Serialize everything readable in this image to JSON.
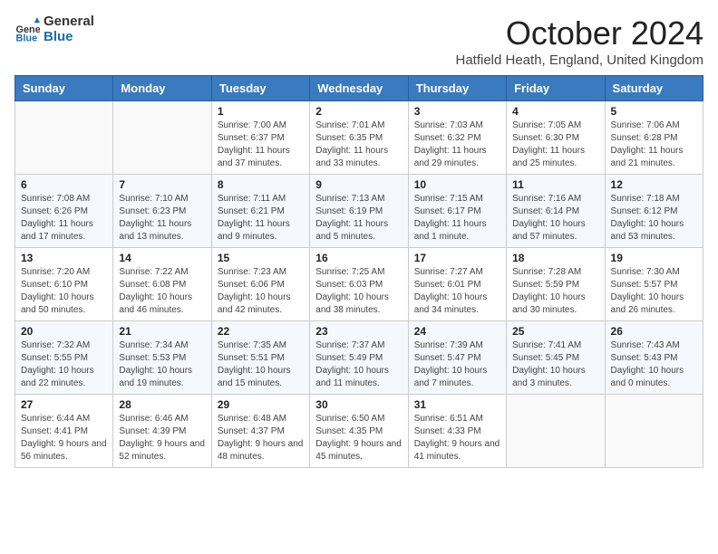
{
  "header": {
    "logo": {
      "general": "General",
      "blue": "Blue"
    },
    "month": "October 2024",
    "location": "Hatfield Heath, England, United Kingdom"
  },
  "days_of_week": [
    "Sunday",
    "Monday",
    "Tuesday",
    "Wednesday",
    "Thursday",
    "Friday",
    "Saturday"
  ],
  "weeks": [
    [
      {
        "day": "",
        "sunrise": "",
        "sunset": "",
        "daylight": ""
      },
      {
        "day": "",
        "sunrise": "",
        "sunset": "",
        "daylight": ""
      },
      {
        "day": "1",
        "sunrise": "Sunrise: 7:00 AM",
        "sunset": "Sunset: 6:37 PM",
        "daylight": "Daylight: 11 hours and 37 minutes."
      },
      {
        "day": "2",
        "sunrise": "Sunrise: 7:01 AM",
        "sunset": "Sunset: 6:35 PM",
        "daylight": "Daylight: 11 hours and 33 minutes."
      },
      {
        "day": "3",
        "sunrise": "Sunrise: 7:03 AM",
        "sunset": "Sunset: 6:32 PM",
        "daylight": "Daylight: 11 hours and 29 minutes."
      },
      {
        "day": "4",
        "sunrise": "Sunrise: 7:05 AM",
        "sunset": "Sunset: 6:30 PM",
        "daylight": "Daylight: 11 hours and 25 minutes."
      },
      {
        "day": "5",
        "sunrise": "Sunrise: 7:06 AM",
        "sunset": "Sunset: 6:28 PM",
        "daylight": "Daylight: 11 hours and 21 minutes."
      }
    ],
    [
      {
        "day": "6",
        "sunrise": "Sunrise: 7:08 AM",
        "sunset": "Sunset: 6:26 PM",
        "daylight": "Daylight: 11 hours and 17 minutes."
      },
      {
        "day": "7",
        "sunrise": "Sunrise: 7:10 AM",
        "sunset": "Sunset: 6:23 PM",
        "daylight": "Daylight: 11 hours and 13 minutes."
      },
      {
        "day": "8",
        "sunrise": "Sunrise: 7:11 AM",
        "sunset": "Sunset: 6:21 PM",
        "daylight": "Daylight: 11 hours and 9 minutes."
      },
      {
        "day": "9",
        "sunrise": "Sunrise: 7:13 AM",
        "sunset": "Sunset: 6:19 PM",
        "daylight": "Daylight: 11 hours and 5 minutes."
      },
      {
        "day": "10",
        "sunrise": "Sunrise: 7:15 AM",
        "sunset": "Sunset: 6:17 PM",
        "daylight": "Daylight: 11 hours and 1 minute."
      },
      {
        "day": "11",
        "sunrise": "Sunrise: 7:16 AM",
        "sunset": "Sunset: 6:14 PM",
        "daylight": "Daylight: 10 hours and 57 minutes."
      },
      {
        "day": "12",
        "sunrise": "Sunrise: 7:18 AM",
        "sunset": "Sunset: 6:12 PM",
        "daylight": "Daylight: 10 hours and 53 minutes."
      }
    ],
    [
      {
        "day": "13",
        "sunrise": "Sunrise: 7:20 AM",
        "sunset": "Sunset: 6:10 PM",
        "daylight": "Daylight: 10 hours and 50 minutes."
      },
      {
        "day": "14",
        "sunrise": "Sunrise: 7:22 AM",
        "sunset": "Sunset: 6:08 PM",
        "daylight": "Daylight: 10 hours and 46 minutes."
      },
      {
        "day": "15",
        "sunrise": "Sunrise: 7:23 AM",
        "sunset": "Sunset: 6:06 PM",
        "daylight": "Daylight: 10 hours and 42 minutes."
      },
      {
        "day": "16",
        "sunrise": "Sunrise: 7:25 AM",
        "sunset": "Sunset: 6:03 PM",
        "daylight": "Daylight: 10 hours and 38 minutes."
      },
      {
        "day": "17",
        "sunrise": "Sunrise: 7:27 AM",
        "sunset": "Sunset: 6:01 PM",
        "daylight": "Daylight: 10 hours and 34 minutes."
      },
      {
        "day": "18",
        "sunrise": "Sunrise: 7:28 AM",
        "sunset": "Sunset: 5:59 PM",
        "daylight": "Daylight: 10 hours and 30 minutes."
      },
      {
        "day": "19",
        "sunrise": "Sunrise: 7:30 AM",
        "sunset": "Sunset: 5:57 PM",
        "daylight": "Daylight: 10 hours and 26 minutes."
      }
    ],
    [
      {
        "day": "20",
        "sunrise": "Sunrise: 7:32 AM",
        "sunset": "Sunset: 5:55 PM",
        "daylight": "Daylight: 10 hours and 22 minutes."
      },
      {
        "day": "21",
        "sunrise": "Sunrise: 7:34 AM",
        "sunset": "Sunset: 5:53 PM",
        "daylight": "Daylight: 10 hours and 19 minutes."
      },
      {
        "day": "22",
        "sunrise": "Sunrise: 7:35 AM",
        "sunset": "Sunset: 5:51 PM",
        "daylight": "Daylight: 10 hours and 15 minutes."
      },
      {
        "day": "23",
        "sunrise": "Sunrise: 7:37 AM",
        "sunset": "Sunset: 5:49 PM",
        "daylight": "Daylight: 10 hours and 11 minutes."
      },
      {
        "day": "24",
        "sunrise": "Sunrise: 7:39 AM",
        "sunset": "Sunset: 5:47 PM",
        "daylight": "Daylight: 10 hours and 7 minutes."
      },
      {
        "day": "25",
        "sunrise": "Sunrise: 7:41 AM",
        "sunset": "Sunset: 5:45 PM",
        "daylight": "Daylight: 10 hours and 3 minutes."
      },
      {
        "day": "26",
        "sunrise": "Sunrise: 7:43 AM",
        "sunset": "Sunset: 5:43 PM",
        "daylight": "Daylight: 10 hours and 0 minutes."
      }
    ],
    [
      {
        "day": "27",
        "sunrise": "Sunrise: 6:44 AM",
        "sunset": "Sunset: 4:41 PM",
        "daylight": "Daylight: 9 hours and 56 minutes."
      },
      {
        "day": "28",
        "sunrise": "Sunrise: 6:46 AM",
        "sunset": "Sunset: 4:39 PM",
        "daylight": "Daylight: 9 hours and 52 minutes."
      },
      {
        "day": "29",
        "sunrise": "Sunrise: 6:48 AM",
        "sunset": "Sunset: 4:37 PM",
        "daylight": "Daylight: 9 hours and 48 minutes."
      },
      {
        "day": "30",
        "sunrise": "Sunrise: 6:50 AM",
        "sunset": "Sunset: 4:35 PM",
        "daylight": "Daylight: 9 hours and 45 minutes."
      },
      {
        "day": "31",
        "sunrise": "Sunrise: 6:51 AM",
        "sunset": "Sunset: 4:33 PM",
        "daylight": "Daylight: 9 hours and 41 minutes."
      },
      {
        "day": "",
        "sunrise": "",
        "sunset": "",
        "daylight": ""
      },
      {
        "day": "",
        "sunrise": "",
        "sunset": "",
        "daylight": ""
      }
    ]
  ]
}
